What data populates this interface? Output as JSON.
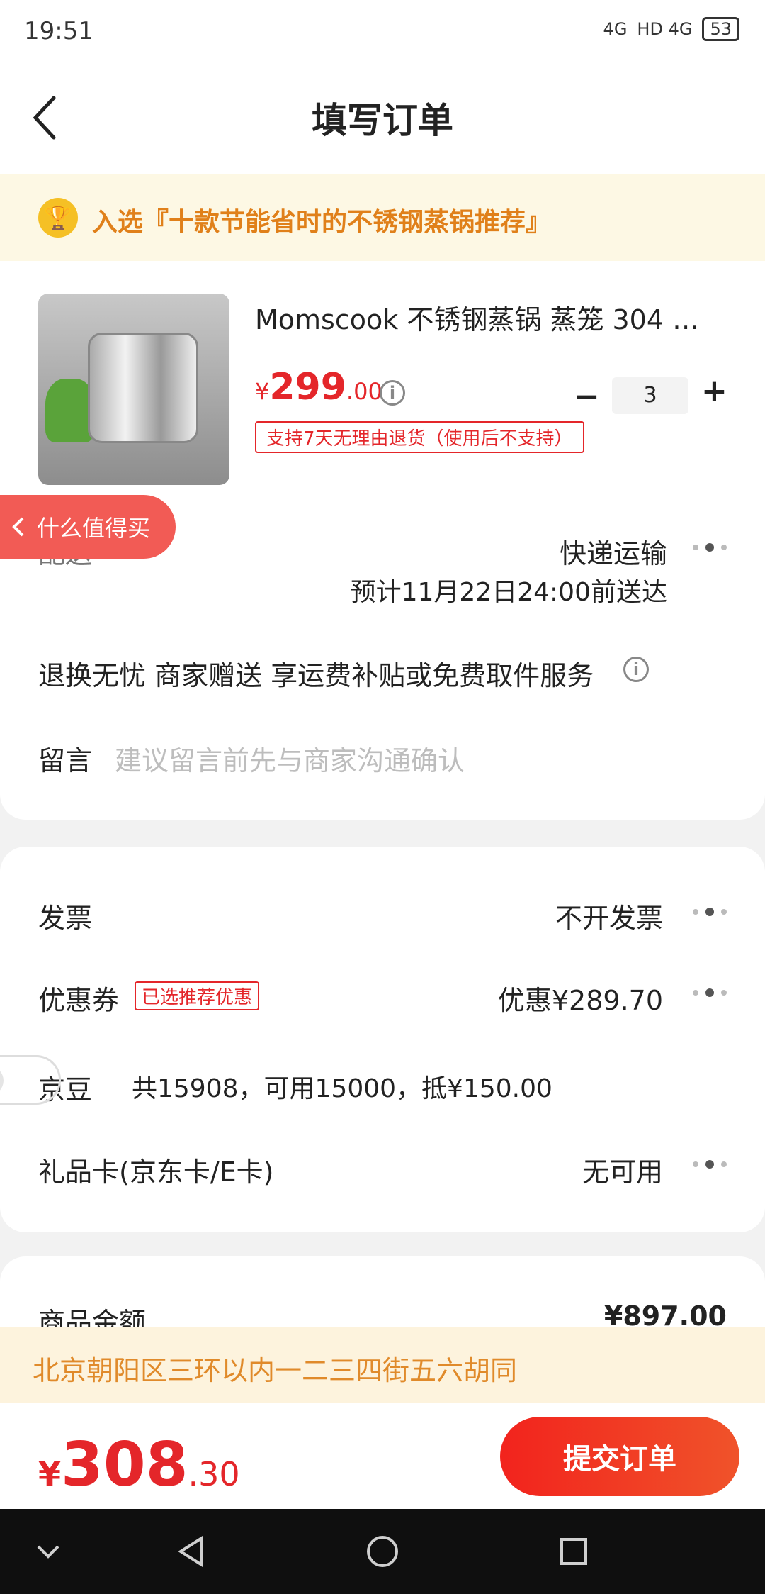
{
  "status_bar": {
    "time": "19:51",
    "network": "4G",
    "signal": "HD 4G",
    "battery": "53"
  },
  "header": {
    "title": "填写订单"
  },
  "banner": {
    "text": "入选『十款节能省时的不锈钢蒸锅推荐』",
    "icon": "trophy-icon"
  },
  "product": {
    "name": "Momscook 不锈钢蒸锅 蒸笼 304 单…",
    "price_symbol": "¥",
    "price_int": "299",
    "price_dec": ".00",
    "return_policy": "支持7天无理由退货（使用后不支持）",
    "quantity": "3"
  },
  "float_button": {
    "label": "什么值得买"
  },
  "delivery": {
    "label": "配送",
    "method": "快递运输",
    "eta": "预计11月22日24:00前送达"
  },
  "return_service": {
    "text": "退换无忧 商家赠送  享运费补贴或免费取件服务"
  },
  "message": {
    "label": "留言",
    "placeholder": "建议留言前先与商家沟通确认"
  },
  "invoice": {
    "label": "发票",
    "value": "不开发票"
  },
  "coupon": {
    "label": "优惠券",
    "tag": "已选推荐优惠",
    "value": "优惠¥289.70"
  },
  "jingdou": {
    "label": "京豆",
    "text": "共15908，可用15000，抵¥150.00",
    "enabled": false
  },
  "giftcard": {
    "label": "礼品卡(京东卡/E卡)",
    "value": "无可用"
  },
  "summary": {
    "goods_label": "商品金额",
    "goods_value": "¥897.00"
  },
  "address": {
    "text": "北京朝阳区三环以内一二三四街五六胡同"
  },
  "bottom": {
    "total_symbol": "¥",
    "total_int": "308",
    "total_dec": ".30",
    "submit_label": "提交订单"
  },
  "colors": {
    "accent": "#e4262a",
    "banner_text": "#e0801a",
    "address_text": "#e08a2a"
  }
}
